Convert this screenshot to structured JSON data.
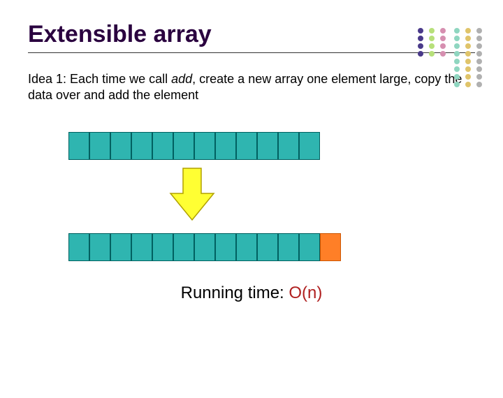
{
  "title": "Extensible array",
  "idea": {
    "prefix": "Idea 1: Each time we call ",
    "emph": "add",
    "suffix": ", create a new array one element large, copy the data over and add the element"
  },
  "array1_cells": 12,
  "array2_cells": 12,
  "array2_extra_cell_color": "orange",
  "running_time": {
    "label": "Running time:  ",
    "value": "O(n)"
  },
  "decor": {
    "dot_colors": [
      "#4a3a8a",
      "#b7e07a",
      "#d68fb0",
      "#8fd6c0",
      "#e0c46a",
      "#b0b0b0"
    ]
  }
}
